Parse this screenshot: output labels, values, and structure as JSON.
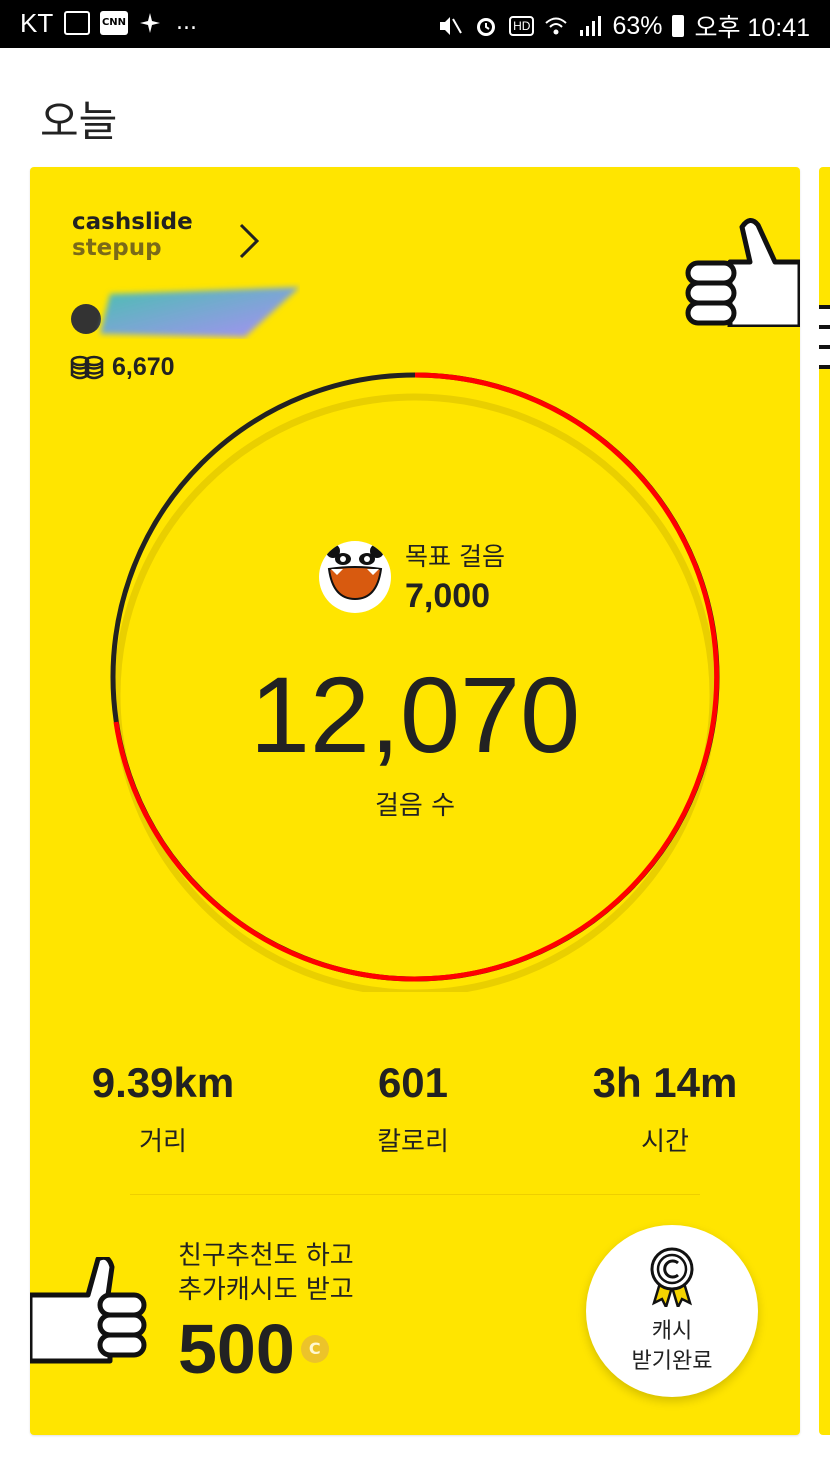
{
  "status_bar": {
    "carrier": "KT",
    "cnn": "CNN",
    "more": "...",
    "hd": "HD",
    "battery": "63%",
    "time": "오후 10:41"
  },
  "page": {
    "title": "오늘"
  },
  "card": {
    "brand_line1": "cashslide",
    "brand_line2": "stepup",
    "coin_balance": "6,670",
    "goal_label": "목표 걸음",
    "goal_value": "7,000",
    "steps": "12,070",
    "steps_label": "걸음 수",
    "stats": [
      {
        "value": "9.39km",
        "label": "거리"
      },
      {
        "value": "601",
        "label": "칼로리"
      },
      {
        "value": "3h 14m",
        "label": "시간"
      }
    ],
    "promo_line1": "친구추천도 하고",
    "promo_line2": "추가캐시도 받고",
    "promo_amount": "500",
    "coin_symbol": "C",
    "cash_button_line1": "캐시",
    "cash_button_line2": "받기완료"
  },
  "colors": {
    "card_bg": "#ffe500",
    "ring_progress": "#ff0000",
    "ring_base": "#222222"
  },
  "icons": [
    "wifi-icon",
    "signal-icon",
    "alarm-icon",
    "mute-icon",
    "thumbs-up-icon",
    "chevron-right-icon",
    "coin-stack-icon",
    "panda-icon",
    "medal-icon"
  ]
}
